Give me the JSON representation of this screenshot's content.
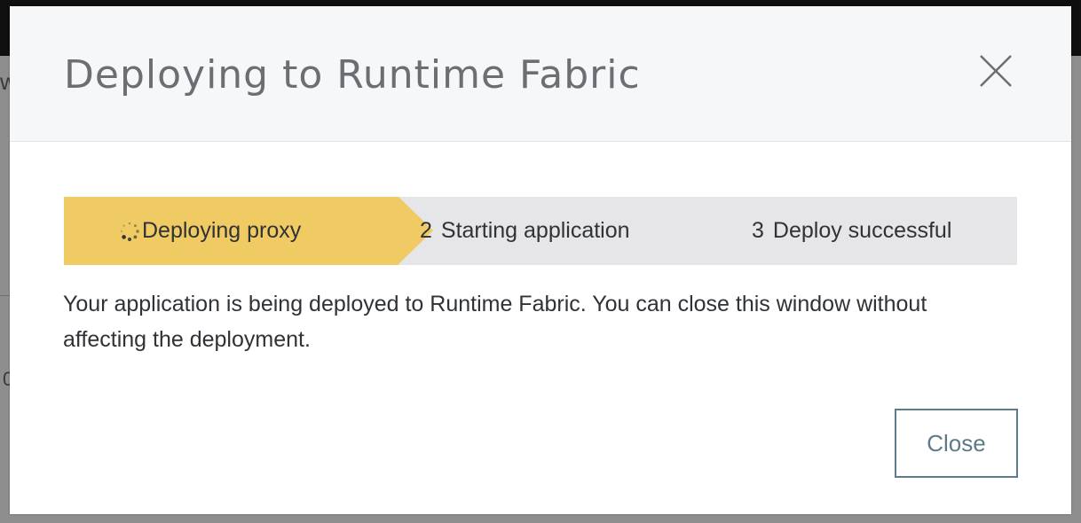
{
  "modal": {
    "title": "Deploying to Runtime Fabric",
    "close_icon": "close-x-icon",
    "message": "Your application is being deployed to Runtime Fabric. You can close this window without affecting the deployment.",
    "close_button_label": "Close"
  },
  "stepper": {
    "steps": [
      {
        "number": "",
        "label": "Deploying proxy",
        "state": "active",
        "icon": "spinner-icon"
      },
      {
        "number": "2",
        "label": "Starting application",
        "state": "pending"
      },
      {
        "number": "3",
        "label": "Deploy successful",
        "state": "pending"
      }
    ]
  },
  "background": {
    "fragments": [
      "w",
      "0"
    ]
  },
  "colors": {
    "active_step": "#f0cb64",
    "pending_step": "#e6e6e8",
    "header_bg": "#f6f7f9",
    "button_border": "#5e7a88",
    "overlay": "#8c8c8c"
  }
}
